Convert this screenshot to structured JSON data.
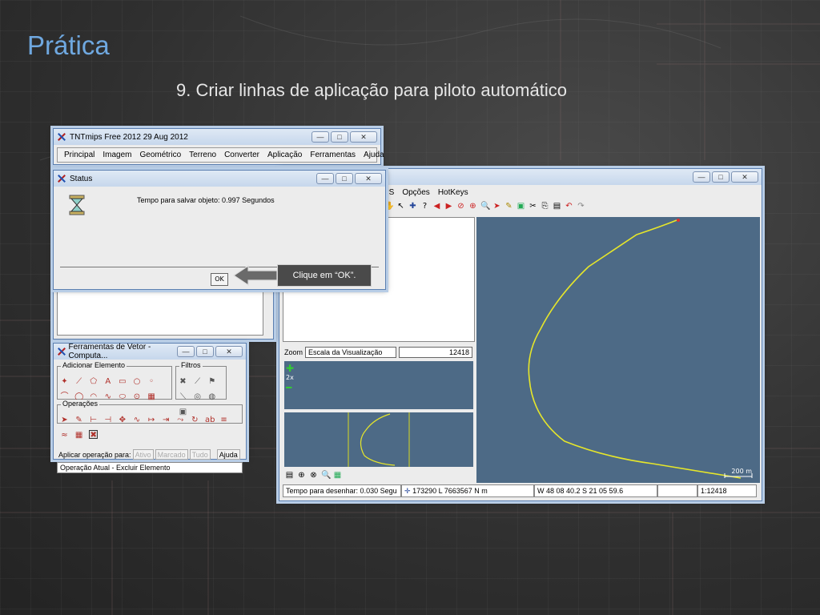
{
  "slide": {
    "title": "Prática",
    "subtitle": "9. Criar linhas de aplicação para piloto automático"
  },
  "main_window": {
    "title": "TNTmips Free 2012   29 Aug 2012",
    "menu": [
      "Principal",
      "Imagem",
      "Geométrico",
      "Terreno",
      "Converter",
      "Aplicação",
      "Ferramentas",
      "Ajuda"
    ]
  },
  "status_dialog": {
    "title": "Status",
    "message": "Tempo para salvar objeto: 0.997 Segundos",
    "ok_label": "OK"
  },
  "callout": {
    "text": "Clique em “OK”."
  },
  "vector_tools": {
    "title": "Ferramentas de Vetor - Computa...",
    "group_add": "Adicionar Elemento",
    "group_filters": "Filtros",
    "group_ops": "Operações",
    "apply_label": "Aplicar operação para:",
    "apply_options": [
      "Ativo",
      "Marcado",
      "Tudo"
    ],
    "help_label": "Ajuda",
    "current_op": "Operação Atual - Excluir Elemento"
  },
  "display_window": {
    "menu": [
      "PS",
      "Opções",
      "HotKeys"
    ],
    "zoom_label": "Zoom",
    "zoom_mode": "Escala da Visualização",
    "zoom_value": "12418",
    "zoom_2x": "2x",
    "scale_bar": "200 m",
    "status": {
      "draw_time": "Tempo para desenhar: 0.030 Segu",
      "coords": "173290 L  7663567 N m",
      "latlon": "W 48 08 40.2  S 21 05 59.6",
      "scale": "1:12418"
    }
  },
  "colors": {
    "title_blue": "#6fa8e0",
    "map_bg": "#4d6a86",
    "line_yellow": "#e6e62a"
  }
}
